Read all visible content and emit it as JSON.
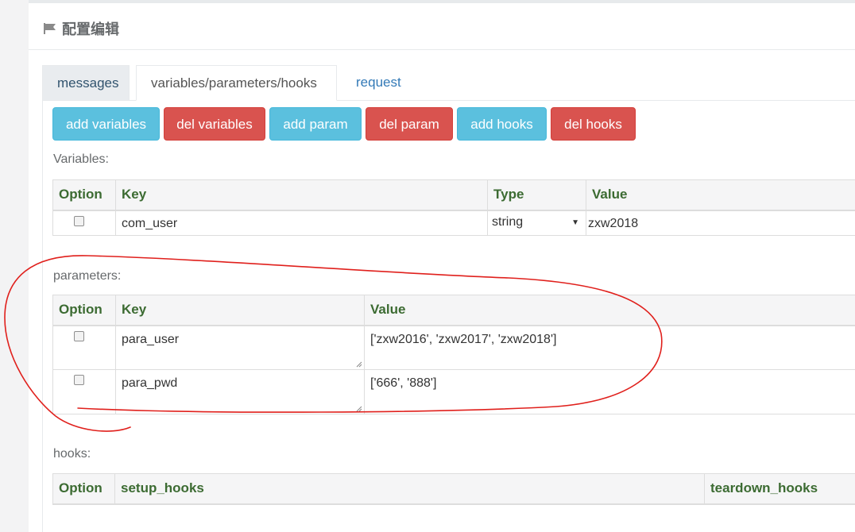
{
  "header": {
    "title": "配置编辑",
    "icon": "flag-icon"
  },
  "tabs": [
    {
      "label": "messages"
    },
    {
      "label": "variables/parameters/hooks",
      "active": true
    },
    {
      "label": "request"
    }
  ],
  "toolbar": {
    "add_variables": "add variables",
    "del_variables": "del variables",
    "add_param": "add param",
    "del_param": "del param",
    "add_hooks": "add hooks",
    "del_hooks": "del hooks"
  },
  "variables": {
    "label": "Variables:",
    "columns": [
      "Option",
      "Key",
      "Type",
      "Value"
    ],
    "rows": [
      {
        "key": "com_user",
        "type": "string",
        "value": "zxw2018"
      }
    ]
  },
  "parameters": {
    "label": "parameters:",
    "columns": [
      "Option",
      "Key",
      "Value"
    ],
    "rows": [
      {
        "key": "para_user",
        "value": "['zxw2016', 'zxw2017', 'zxw2018']"
      },
      {
        "key": "para_pwd",
        "value": "['666', '888']"
      }
    ]
  },
  "hooks": {
    "label": "hooks:",
    "columns": [
      "Option",
      "setup_hooks",
      "teardown_hooks"
    ]
  },
  "colors": {
    "info": "#5bc0de",
    "danger": "#d9534f",
    "header_text": "#3c6b32",
    "link": "#337ab7",
    "annotation": "#e0201c"
  }
}
